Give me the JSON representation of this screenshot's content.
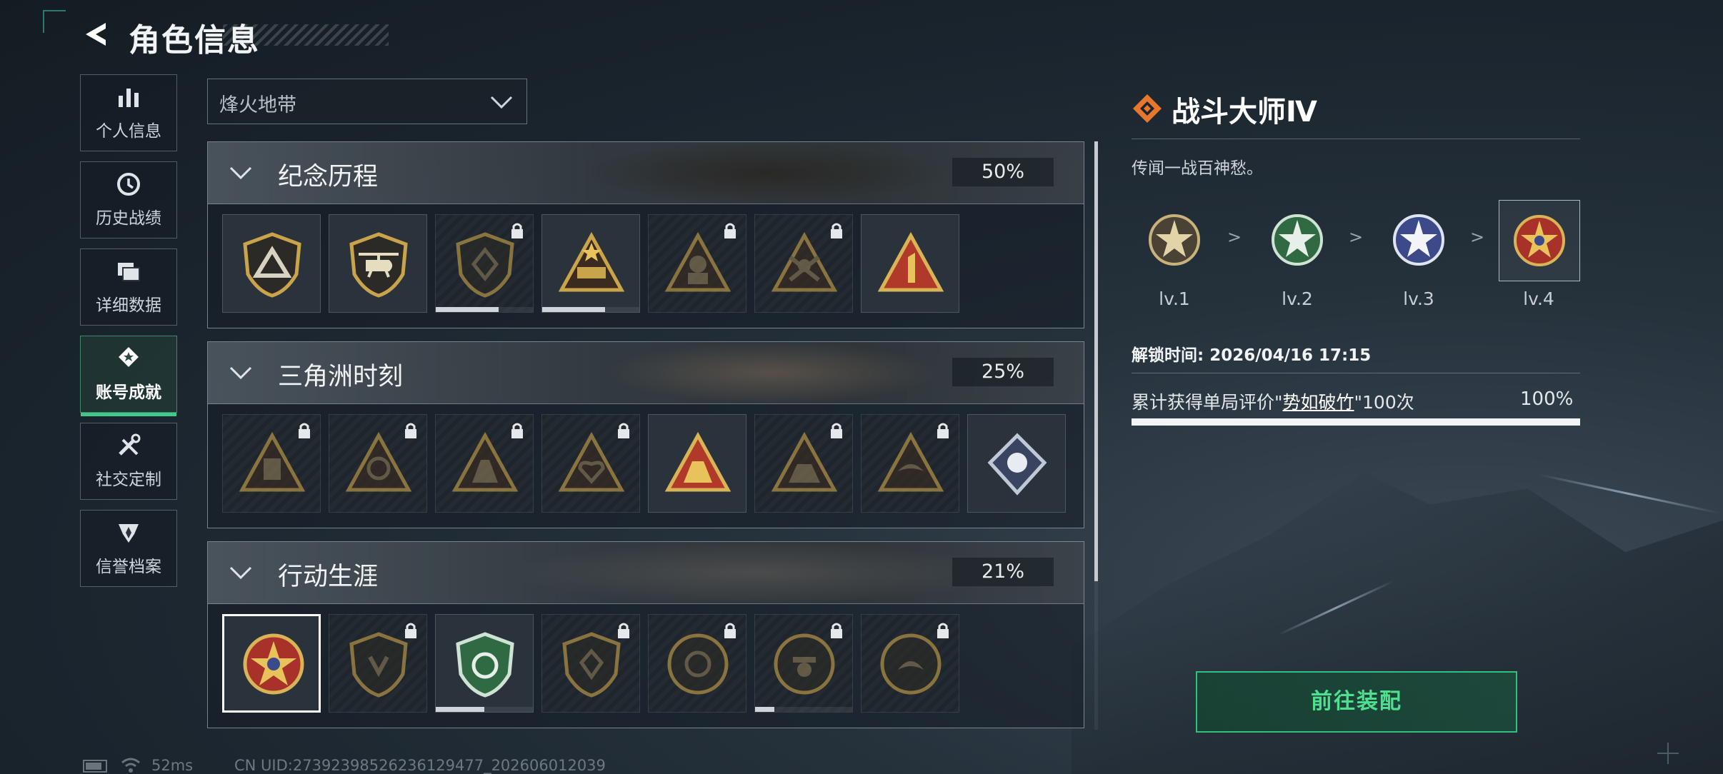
{
  "header": {
    "title": "角色信息"
  },
  "sidebar": {
    "items": [
      {
        "label": "个人信息",
        "icon": "bar-chart-icon",
        "active": false
      },
      {
        "label": "历史战绩",
        "icon": "history-clock-icon",
        "active": false
      },
      {
        "label": "详细数据",
        "icon": "folder-icon",
        "active": false
      },
      {
        "label": "账号成就",
        "icon": "achievement-medal-icon",
        "active": true
      },
      {
        "label": "社交定制",
        "icon": "tools-icon",
        "active": false
      },
      {
        "label": "信誉档案",
        "icon": "shield-wing-icon",
        "active": false
      }
    ]
  },
  "filter": {
    "selected": "烽火地带"
  },
  "sections": [
    {
      "name": "纪念历程",
      "percent": "50%",
      "badges": [
        {
          "locked": false
        },
        {
          "locked": false
        },
        {
          "locked": true,
          "progress": 0.65
        },
        {
          "locked": false,
          "progress": 0.65
        },
        {
          "locked": true
        },
        {
          "locked": true
        },
        {
          "locked": false
        }
      ]
    },
    {
      "name": "三角洲时刻",
      "percent": "25%",
      "badges": [
        {
          "locked": true
        },
        {
          "locked": true
        },
        {
          "locked": true
        },
        {
          "locked": true
        },
        {
          "locked": false
        },
        {
          "locked": true
        },
        {
          "locked": true
        },
        {
          "locked": false
        }
      ]
    },
    {
      "name": "行动生涯",
      "percent": "21%",
      "badges": [
        {
          "locked": false,
          "selected": true
        },
        {
          "locked": true
        },
        {
          "locked": false,
          "progress": 0.5
        },
        {
          "locked": true
        },
        {
          "locked": true
        },
        {
          "locked": true,
          "progress": 0.2
        },
        {
          "locked": true
        }
      ]
    }
  ],
  "detail": {
    "title": "战斗大师Ⅳ",
    "description": "传闻一战百神愁。",
    "levels": [
      "lv.1",
      "lv.2",
      "lv.3",
      "lv.4"
    ],
    "level_separator": ">",
    "unlock_time": "解锁时间: 2026/04/16 17:15",
    "condition_prefix": "累计获得单局评价\"",
    "condition_highlight": "势如破竹",
    "condition_suffix": "\"100次",
    "condition_percent": "100%",
    "condition_progress": 1.0
  },
  "equip_button": "前往装配",
  "status": {
    "ping": "52ms",
    "uid": "CN UID:27392398526236129477_202606012039"
  },
  "colors": {
    "accent_green": "#42c98a",
    "detail_icon": "#e8772e",
    "gold": "#c9a44a"
  }
}
